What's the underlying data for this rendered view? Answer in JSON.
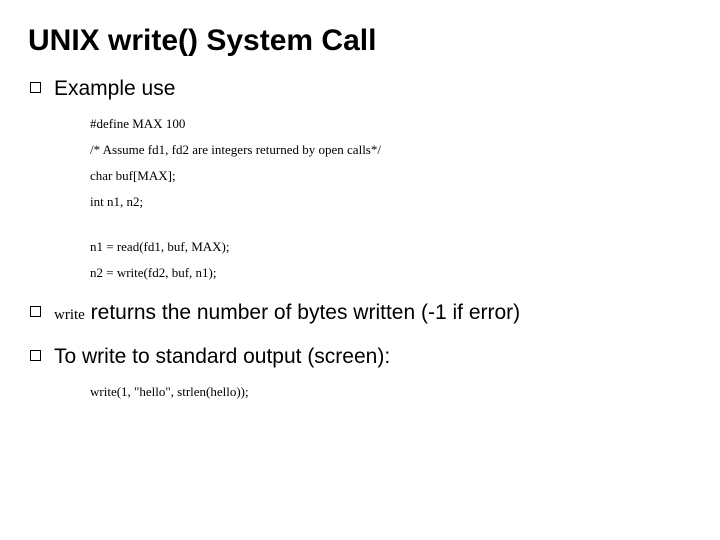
{
  "title": "UNIX write() System Call",
  "bullets": {
    "b1": "Example use",
    "b2_prefix": "write",
    "b2_rest": " returns the number of bytes written (-1 if error)",
    "b3": "To write to standard output (screen):"
  },
  "code": {
    "l1": "#define MAX 100",
    "l2": "/* Assume fd1, fd2 are integers returned by open calls*/",
    "l3": "char buf[MAX];",
    "l4": "int n1, n2;",
    "l5": "n1 = read(fd1, buf, MAX);",
    "l6": "n2 = write(fd2, buf, n1);",
    "l7": "write(1, \"hello\", strlen(hello));"
  }
}
